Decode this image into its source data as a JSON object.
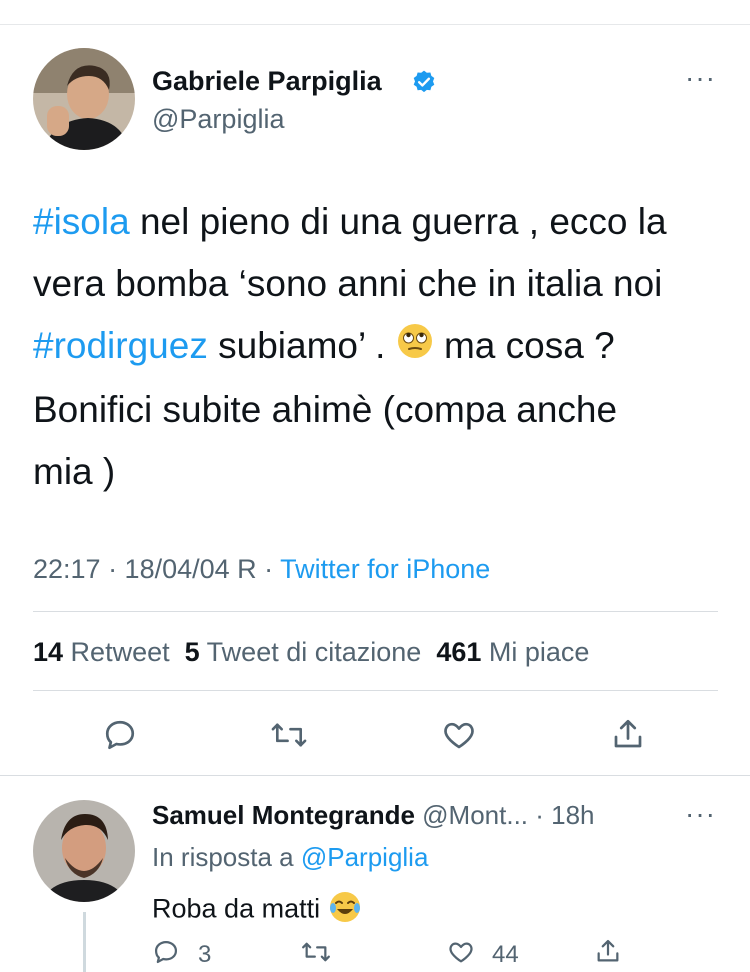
{
  "tweet": {
    "author_name": "Gabriele Parpiglia",
    "author_handle": "@Parpiglia",
    "more": "···",
    "text": {
      "l1_tag": "#isola",
      "l1_rest": " nel pieno di una guerra , ecco la",
      "l2": "vera bomba ‘sono anni che in italia noi",
      "l3_tag": "#rodirguez",
      "l3_rest_a": " subiamo’ . ",
      "l3_rest_b": " ma cosa ?",
      "l4": "Bonifici subite ahimè (compa anche",
      "l5": "mia )"
    },
    "time": "22:17 · 18/04/04 R · ",
    "source": "Twitter for iPhone",
    "stats": {
      "retweets_count": "14",
      "retweets_label": " Retweet",
      "quotes_count": "5",
      "quotes_label": " Tweet di citazione",
      "likes_count": "461",
      "likes_label": " Mi piace"
    }
  },
  "reply": {
    "author_name": "Samuel Montegrande",
    "author_handle": " @Mont...",
    "age": " · 18h",
    "more": "···",
    "in_reply_prefix": "In risposta a ",
    "in_reply_handle": "@Parpiglia",
    "text": "Roba da matti ",
    "replies": "3",
    "likes": "44"
  },
  "colors": {
    "accent": "#1d9bf0",
    "verified": "#1d9bf0",
    "secondary_text": "#536471",
    "icon": "#536471"
  },
  "icons": [
    "verified-badge-icon",
    "more-icon",
    "reply-icon",
    "retweet-icon",
    "like-icon",
    "share-icon",
    "face-with-rolling-eyes-emoji",
    "tears-of-joy-emoji"
  ]
}
